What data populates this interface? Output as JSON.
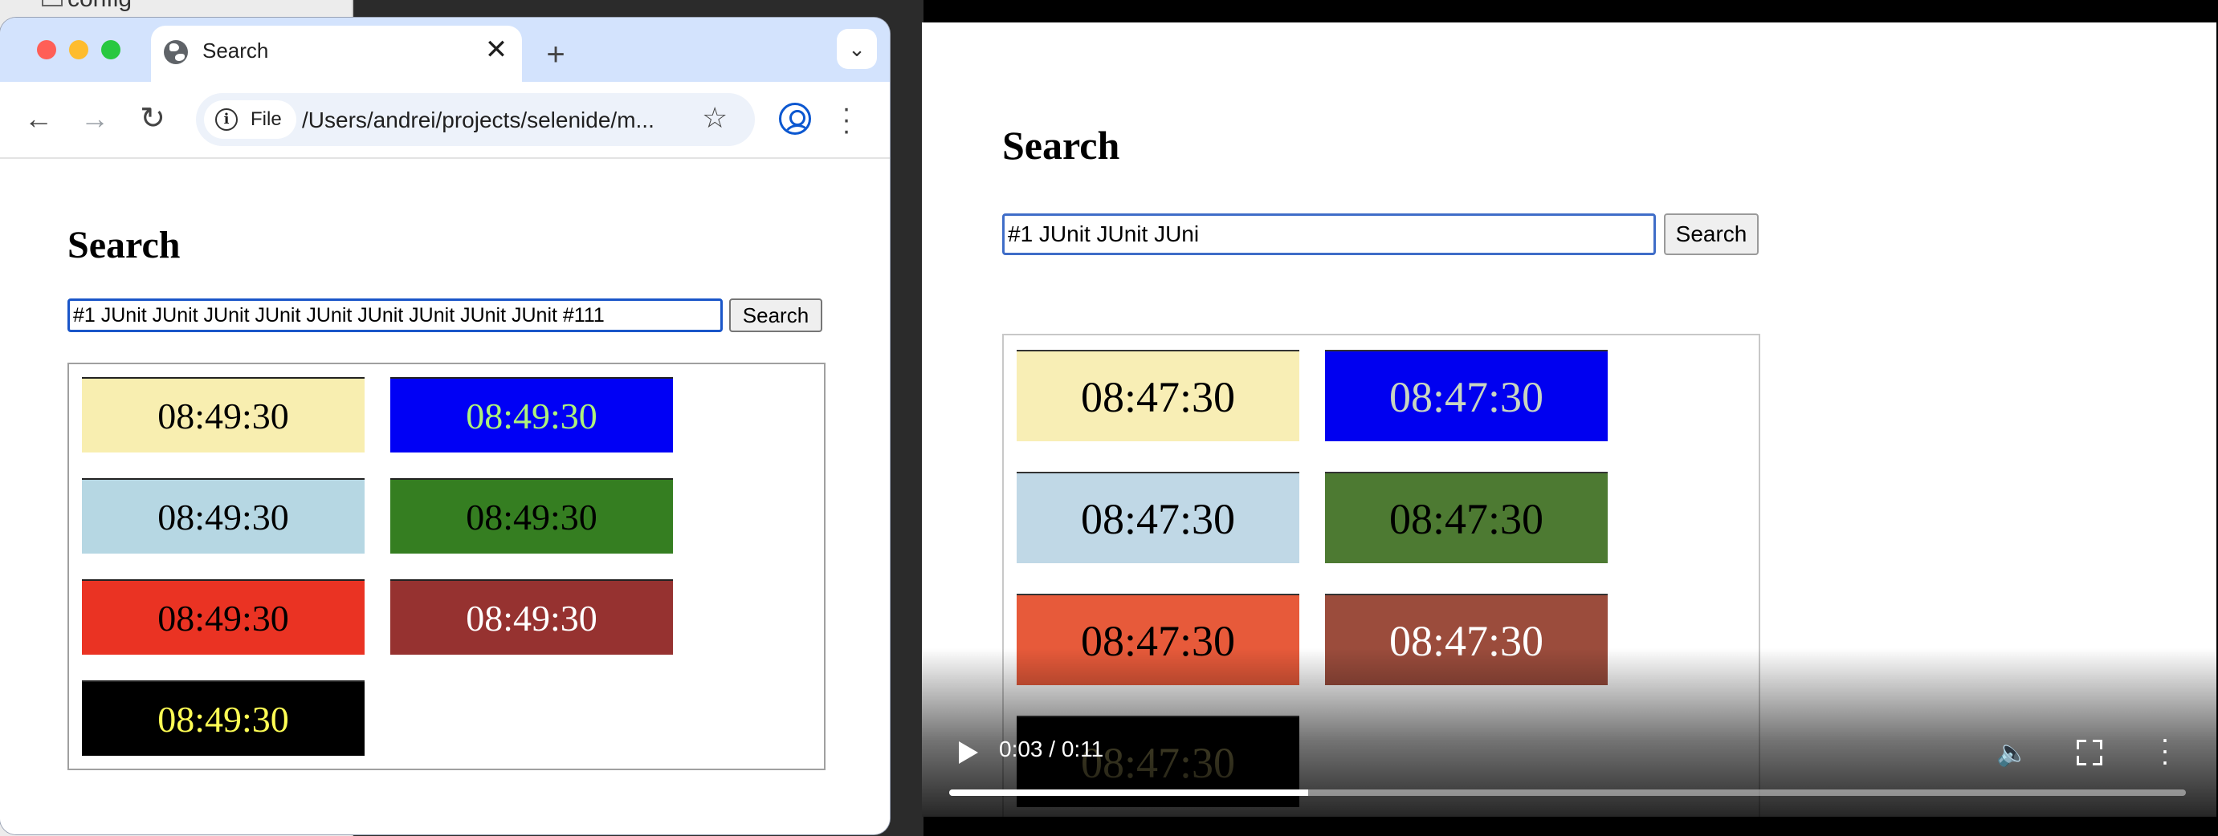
{
  "desktop": {
    "finder_item": "config"
  },
  "browser": {
    "tab": {
      "title": "Search"
    },
    "new_tab_label": "+",
    "close_tab_label": "✕",
    "file_chip": "File",
    "url": "/Users/andrei/projects/selenide/m..."
  },
  "page": {
    "title": "Search",
    "search_value": "#1 JUnit JUnit JUnit JUnit JUnit JUnit JUnit JUnit JUnit #111",
    "search_button": "Search",
    "clocks": [
      {
        "time": "08:49:30",
        "bg": "#f8eeb0",
        "fg": "#000000"
      },
      {
        "time": "08:49:30",
        "bg": "#0000f5",
        "fg": "#aef27a"
      },
      {
        "time": "08:49:30",
        "bg": "#b6d7e3",
        "fg": "#000000"
      },
      {
        "time": "08:49:30",
        "bg": "#357e21",
        "fg": "#000000"
      },
      {
        "time": "08:49:30",
        "bg": "#ea3323",
        "fg": "#000000"
      },
      {
        "time": "08:49:30",
        "bg": "#963230",
        "fg": "#ffffff"
      },
      {
        "time": "08:49:30",
        "bg": "#000000",
        "fg": "#fffe54"
      }
    ]
  },
  "video": {
    "title": "Search",
    "search_value": "#1 JUnit JUnit JUni",
    "search_button": "Search",
    "clocks": [
      {
        "time": "08:47:30",
        "bg": "#f8eeb5",
        "fg": "#000000"
      },
      {
        "time": "08:47:30",
        "bg": "#0000f0",
        "fg": "#c9d6c0"
      },
      {
        "time": "08:47:30",
        "bg": "#c0d8e6",
        "fg": "#000000"
      },
      {
        "time": "08:47:30",
        "bg": "#4d7a32",
        "fg": "#000000"
      },
      {
        "time": "08:47:30",
        "bg": "#e75a3a",
        "fg": "#000000"
      },
      {
        "time": "08:47:30",
        "bg": "#9b4c3c",
        "fg": "#ffffff"
      },
      {
        "time": "08:47:30",
        "bg": "#000000",
        "fg": "#8a8250"
      }
    ],
    "time_display": "0:03 / 0:11",
    "progress": 0.29
  }
}
